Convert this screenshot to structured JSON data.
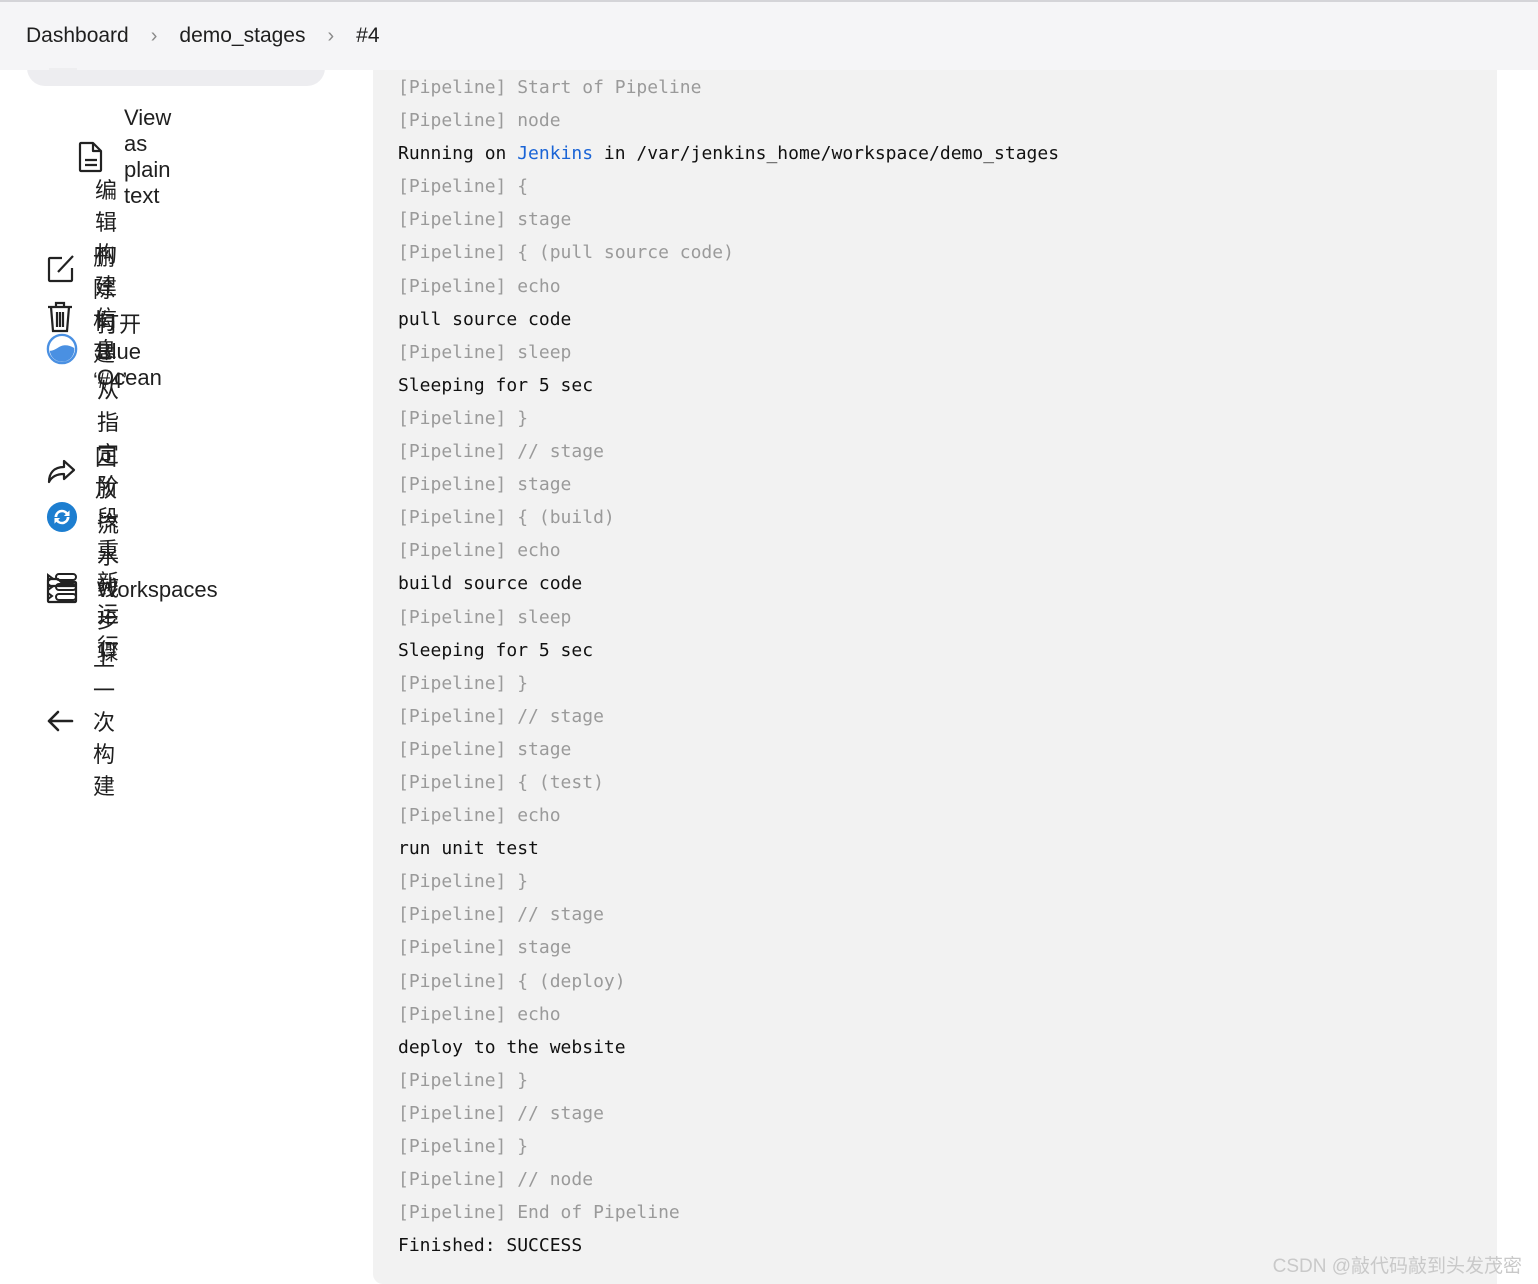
{
  "breadcrumb": [
    "Dashboard",
    "demo_stages",
    "#4"
  ],
  "sidebar": {
    "items": [
      {
        "label": "View as plain text",
        "icon": "document-icon"
      },
      {
        "label": "编辑构建信息",
        "icon": "edit-icon"
      },
      {
        "label": "删除构建 ‘#4’",
        "icon": "trash-icon"
      },
      {
        "label": "打开 Blue Ocean",
        "icon": "blue-ocean-icon"
      },
      {
        "label": "从指定阶段重新运行",
        "icon": "restart-stage-icon"
      },
      {
        "label": "回放",
        "icon": "replay-icon"
      },
      {
        "label": "流水线步骤",
        "icon": "pipeline-steps-icon"
      },
      {
        "label": "Workspaces",
        "icon": "folder-icon"
      },
      {
        "label": "上一次构建",
        "icon": "arrow-left-icon"
      }
    ]
  },
  "console": {
    "running_prefix": "Running on ",
    "running_link": "Jenkins",
    "running_suffix": " in /var/jenkins_home/workspace/demo_stages",
    "lines": [
      {
        "t": "[Pipeline] Start of Pipeline",
        "k": "g"
      },
      {
        "t": "[Pipeline] node",
        "k": "g"
      },
      {
        "t": "RUNNING",
        "k": "r"
      },
      {
        "t": "[Pipeline] {",
        "k": "g"
      },
      {
        "t": "[Pipeline] stage",
        "k": "g"
      },
      {
        "t": "[Pipeline] { (pull source code)",
        "k": "g"
      },
      {
        "t": "[Pipeline] echo",
        "k": "g"
      },
      {
        "t": "pull source code",
        "k": "b"
      },
      {
        "t": "[Pipeline] sleep",
        "k": "g"
      },
      {
        "t": "Sleeping for 5 sec",
        "k": "b"
      },
      {
        "t": "[Pipeline] }",
        "k": "g"
      },
      {
        "t": "[Pipeline] // stage",
        "k": "g"
      },
      {
        "t": "[Pipeline] stage",
        "k": "g"
      },
      {
        "t": "[Pipeline] { (build)",
        "k": "g"
      },
      {
        "t": "[Pipeline] echo",
        "k": "g"
      },
      {
        "t": "build source code",
        "k": "b"
      },
      {
        "t": "[Pipeline] sleep",
        "k": "g"
      },
      {
        "t": "Sleeping for 5 sec",
        "k": "b"
      },
      {
        "t": "[Pipeline] }",
        "k": "g"
      },
      {
        "t": "[Pipeline] // stage",
        "k": "g"
      },
      {
        "t": "[Pipeline] stage",
        "k": "g"
      },
      {
        "t": "[Pipeline] { (test)",
        "k": "g"
      },
      {
        "t": "[Pipeline] echo",
        "k": "g"
      },
      {
        "t": "run unit test",
        "k": "b"
      },
      {
        "t": "[Pipeline] }",
        "k": "g"
      },
      {
        "t": "[Pipeline] // stage",
        "k": "g"
      },
      {
        "t": "[Pipeline] stage",
        "k": "g"
      },
      {
        "t": "[Pipeline] { (deploy)",
        "k": "g"
      },
      {
        "t": "[Pipeline] echo",
        "k": "g"
      },
      {
        "t": "deploy to the website",
        "k": "b"
      },
      {
        "t": "[Pipeline] }",
        "k": "g"
      },
      {
        "t": "[Pipeline] // stage",
        "k": "g"
      },
      {
        "t": "[Pipeline] }",
        "k": "g"
      },
      {
        "t": "[Pipeline] // node",
        "k": "g"
      },
      {
        "t": "[Pipeline] End of Pipeline",
        "k": "g"
      },
      {
        "t": "Finished: SUCCESS",
        "k": "b"
      }
    ]
  },
  "watermark": "CSDN @敲代码敲到头发茂密",
  "colors": {
    "link": "#1a64d6",
    "console_bg": "#f2f2f2",
    "muted": "#9a9a9a",
    "blue_ocean": "#4a90e2"
  }
}
